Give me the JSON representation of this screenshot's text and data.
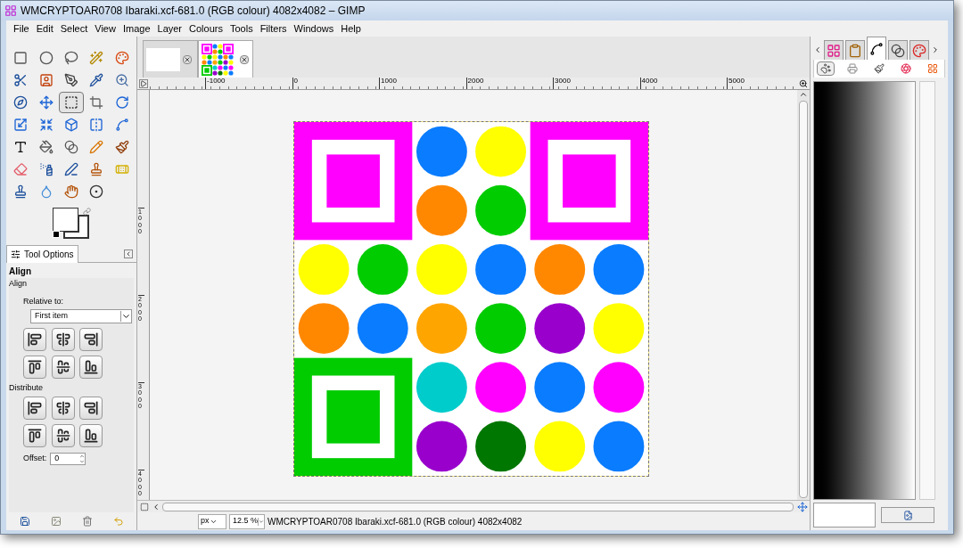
{
  "window": {
    "title": "WMCRYPTOAR0708 Ibaraki.xcf-681.0 (RGB colour) 4082x4082 – GIMP"
  },
  "menu": [
    "File",
    "Edit",
    "Select",
    "View",
    "Image",
    "Layer",
    "Colours",
    "Tools",
    "Filters",
    "Windows",
    "Help"
  ],
  "toolbox": {
    "tools": [
      {
        "selected": false
      },
      {
        "selected": false
      },
      {
        "selected": false
      },
      {
        "selected": false
      },
      {
        "selected": false
      },
      {
        "selected": false
      },
      {
        "selected": false
      },
      {
        "selected": false
      },
      {
        "selected": false
      },
      {
        "selected": false
      },
      {
        "selected": false
      },
      {
        "selected": false
      },
      {
        "selected": true
      },
      {
        "selected": false
      },
      {
        "selected": false
      },
      {
        "selected": false
      },
      {
        "selected": false
      },
      {
        "selected": false
      },
      {
        "selected": false
      },
      {
        "selected": false
      },
      {
        "selected": false
      },
      {
        "selected": false
      },
      {
        "selected": false
      },
      {
        "selected": false
      },
      {
        "selected": false
      },
      {
        "selected": false
      },
      {
        "selected": false
      },
      {
        "selected": false
      },
      {
        "selected": false
      },
      {
        "selected": false
      },
      {
        "selected": false
      },
      {
        "selected": false
      },
      {
        "selected": false
      },
      {
        "selected": false
      }
    ]
  },
  "tool_options": {
    "tab": "Tool Options",
    "title": "Align",
    "section": "Align",
    "relative_to_label": "Relative to:",
    "relative_to_value": "First item",
    "distribute_label": "Distribute",
    "offset_label": "Offset:",
    "offset_value": "0"
  },
  "image_tabs": [
    {
      "selected": false
    },
    {
      "selected": true
    }
  ],
  "rulers": {
    "horizontal": [
      "-1000",
      "0",
      "1000",
      "2000",
      "3000",
      "4000",
      "5000"
    ],
    "vertical": [
      "1000",
      "2000",
      "3000",
      "4000"
    ]
  },
  "status_bar": {
    "unit": "px",
    "zoom": "12.5 %",
    "info": "WMCRYPTOAR0708 Ibaraki.xcf-681.0 (RGB colour) 4082x4082"
  },
  "right_panel": {
    "tabs": [
      {
        "selected": false
      },
      {
        "selected": false
      },
      {
        "selected": true
      },
      {
        "selected": false
      },
      {
        "selected": false
      }
    ],
    "subtabs": [
      {
        "selected": true
      },
      {
        "selected": false
      },
      {
        "selected": false
      },
      {
        "selected": false
      },
      {
        "selected": false
      }
    ]
  }
}
